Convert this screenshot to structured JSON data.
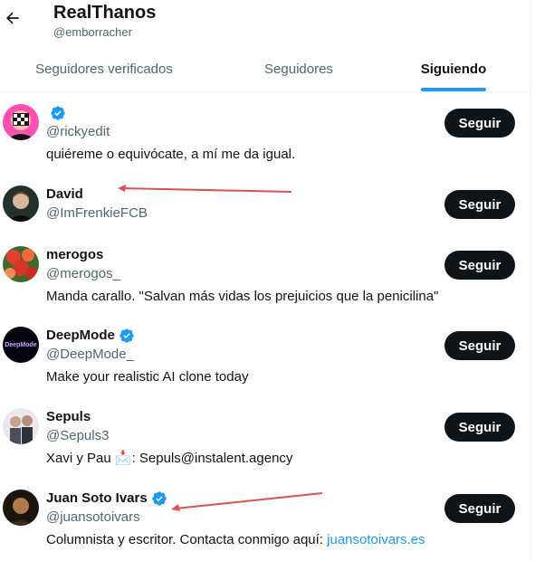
{
  "header": {
    "title": "RealThanos",
    "handle": "@emborracher"
  },
  "tabs": [
    {
      "label": "Seguidores verificados",
      "active": false
    },
    {
      "label": "Seguidores",
      "active": false
    },
    {
      "label": "Siguiendo",
      "active": true
    }
  ],
  "users": [
    {
      "name": "",
      "handle": "@rickyedit",
      "verified": true,
      "bio": "quiéreme o equivócate, a mí me da igual.",
      "follow_label": "Seguir"
    },
    {
      "name": "David",
      "handle": "@ImFrenkieFCB",
      "verified": false,
      "bio": "",
      "follow_label": "Seguir"
    },
    {
      "name": "merogos",
      "handle": "@merogos_",
      "verified": false,
      "bio": "Manda carallo. \"Salvan más vidas los prejuicios que la penicilina\"",
      "follow_label": "Seguir"
    },
    {
      "name": "DeepMode",
      "handle": "@DeepMode_",
      "verified": true,
      "bio": "Make your realistic AI clone today",
      "avatar_text": "DeepMode",
      "follow_label": "Seguir"
    },
    {
      "name": "Sepuls",
      "handle": "@Sepuls3",
      "verified": false,
      "bio_before": "Xavi y Pau",
      "bio_emoji": "📩",
      "bio_after": ": Sepuls@instalent.agency",
      "follow_label": "Seguir"
    },
    {
      "name": "Juan Soto Ivars",
      "handle": "@juansotoivars",
      "verified": true,
      "bio_before": "Columnista y escritor. Contacta conmigo aquí: ",
      "bio_link": "juansotoivars.es",
      "follow_label": "Seguir"
    }
  ],
  "colors": {
    "accent": "#1d9bf0",
    "button": "#0f1419",
    "annotation_arrow": "#d9534f"
  }
}
